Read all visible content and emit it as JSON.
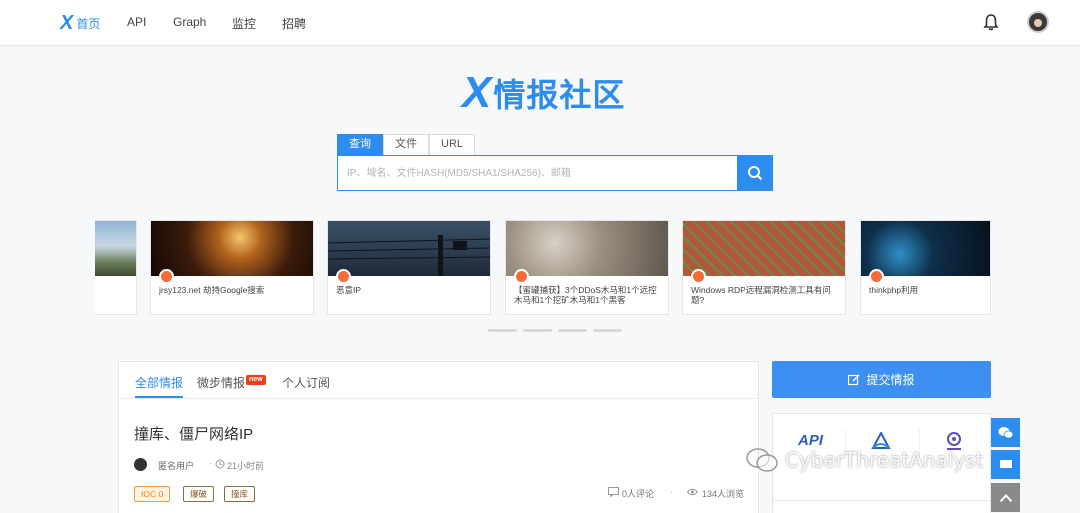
{
  "nav": {
    "logo_glyph": "X",
    "home": "首页",
    "items": [
      "API",
      "Graph",
      "监控",
      "招聘"
    ],
    "bell_icon": "bell-icon",
    "avatar_icon": "avatar"
  },
  "brand": {
    "logo_glyph": "X",
    "title": "情报社区",
    "color": "#2d8cf0"
  },
  "search": {
    "tabs": [
      "查询",
      "文件",
      "URL"
    ],
    "active_tab": "查询",
    "placeholder": "IP、域名、文件HASH(MD5/SHA1/SHA256)、邮箱",
    "button_icon": "search-icon"
  },
  "carousel": {
    "cards": [
      {
        "caption": ""
      },
      {
        "caption": "jrsy123.net 劫持Google搜索"
      },
      {
        "caption": "恶意IP"
      },
      {
        "caption": "【蜜罐捕获】3个DDoS木马和1个远控木马和1个挖矿木马和1个黑客"
      },
      {
        "caption": "Windows RDP远程漏洞检测工具有问题?"
      },
      {
        "caption": "thinkphp利用"
      }
    ],
    "dot_count": 4
  },
  "feed": {
    "tabs": [
      "全部情报",
      "微步情报",
      "个人订阅"
    ],
    "active_tab": "全部情报",
    "new_badge": "new",
    "post": {
      "title": "撞库、僵尸网络IP",
      "user": "匿名用户",
      "separator": "·",
      "time": "21小时前",
      "tags": [
        "IOC 0",
        "爆破",
        "撞库"
      ],
      "comments": "0人评论",
      "views": "134人浏览"
    }
  },
  "sidebar": {
    "submit_label": "提交情报",
    "tools": [
      {
        "label": "API",
        "icon": "api-icon"
      },
      {
        "label": "",
        "icon": "graph-icon"
      },
      {
        "label": "",
        "icon": "monitor-icon"
      }
    ]
  },
  "watermark": {
    "text": "CyberThreatAnalyst"
  },
  "colors": {
    "accent": "#2d8cf0",
    "tag_orange": "#ff7a00",
    "new_red": "#ed3f14"
  }
}
